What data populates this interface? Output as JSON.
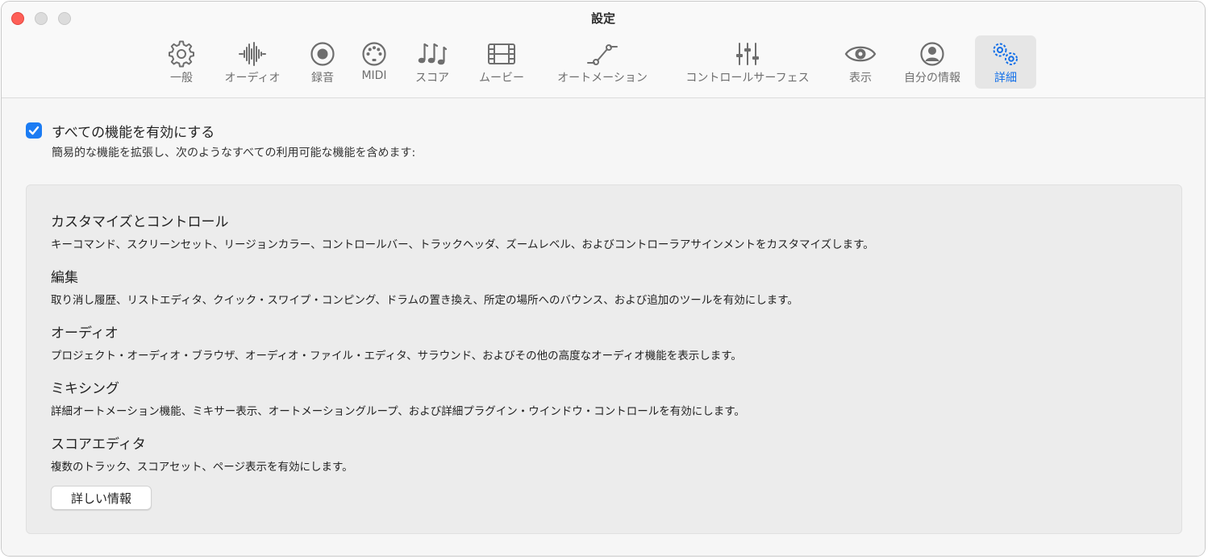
{
  "window": {
    "title": "設定"
  },
  "toolbar": {
    "items": [
      {
        "label": "一般",
        "icon": "gear-icon"
      },
      {
        "label": "オーディオ",
        "icon": "waveform-icon"
      },
      {
        "label": "録音",
        "icon": "record-icon"
      },
      {
        "label": "MIDI",
        "icon": "midi-port-icon"
      },
      {
        "label": "スコア",
        "icon": "music-notes-icon"
      },
      {
        "label": "ムービー",
        "icon": "film-icon"
      },
      {
        "label": "オートメーション",
        "icon": "automation-curve-icon"
      },
      {
        "label": "コントロールサーフェス",
        "icon": "sliders-icon"
      },
      {
        "label": "表示",
        "icon": "eye-icon"
      },
      {
        "label": "自分の情報",
        "icon": "person-icon"
      },
      {
        "label": "詳細",
        "icon": "gears-icon",
        "selected": true
      }
    ]
  },
  "advanced": {
    "enable_all_label": "すべての機能を有効にする",
    "enable_all_checked": true,
    "enable_all_description": "簡易的な機能を拡張し、次のようなすべての利用可能な機能を含めます:",
    "features": [
      {
        "title": "カスタマイズとコントロール",
        "description": "キーコマンド、スクリーンセット、リージョンカラー、コントロールバー、トラックヘッダ、ズームレベル、およびコントローラアサインメントをカスタマイズします。"
      },
      {
        "title": "編集",
        "description": "取り消し履歴、リストエディタ、クイック・スワイプ・コンピング、ドラムの置き換え、所定の場所へのバウンス、および追加のツールを有効にします。"
      },
      {
        "title": "オーディオ",
        "description": "プロジェクト・オーディオ・ブラウザ、オーディオ・ファイル・エディタ、サラウンド、およびその他の高度なオーディオ機能を表示します。"
      },
      {
        "title": "ミキシング",
        "description": "詳細オートメーション機能、ミキサー表示、オートメーショングループ、および詳細プラグイン・ウインドウ・コントロールを有効にします。"
      },
      {
        "title": "スコアエディタ",
        "description": "複数のトラック、スコアセット、ページ表示を有効にします。"
      }
    ],
    "more_info_button": "詳しい情報"
  },
  "colors": {
    "accent": "#1b7cf3",
    "selected_icon": "#1470e8",
    "close_button": "#fe5f57"
  }
}
